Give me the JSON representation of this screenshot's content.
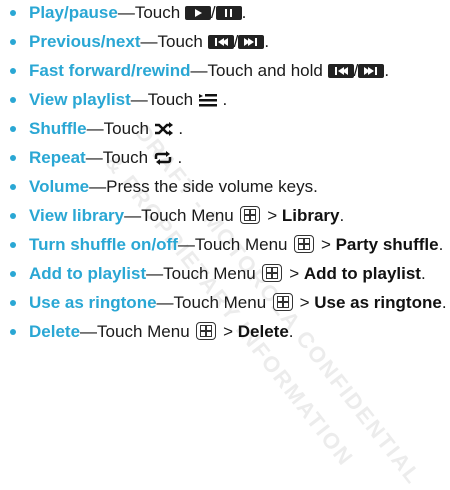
{
  "items": [
    {
      "title": "Play/pause",
      "pre": "—Touch ",
      "post": "."
    },
    {
      "title": "Previous/next",
      "pre": "—Touch ",
      "post": "."
    },
    {
      "title": "Fast forward/rewind",
      "pre": "—Touch and hold ",
      "post": "."
    },
    {
      "title": "View playlist",
      "pre": "—Touch ",
      "post": " ."
    },
    {
      "title": "Shuffle",
      "pre": "—Touch ",
      "post": " ."
    },
    {
      "title": "Repeat",
      "pre": "—Touch ",
      "post": " ."
    },
    {
      "title": "Volume",
      "pre": "—Press the side volume keys."
    },
    {
      "title": "View library",
      "pre": "—Touch Menu ",
      "gt": " > ",
      "bold": "Library",
      "post": "."
    },
    {
      "title": "Turn shuffle on/off",
      "pre": "—Touch Menu ",
      "gt": " > ",
      "bold": "Party shuffle",
      "post": "."
    },
    {
      "title": "Add to playlist",
      "pre": "—Touch Menu ",
      "gt": " > ",
      "bold": "Add to playlist",
      "post": "."
    },
    {
      "title": "Use as ringtone",
      "pre": "—Touch Menu ",
      "gt": " > ",
      "bold": "Use as ringtone",
      "post": "."
    },
    {
      "title": "Delete",
      "pre": "—Touch Menu ",
      "gt": " > ",
      "bold": "Delete",
      "post": "."
    }
  ],
  "slash": "/",
  "watermark": {
    "line1": "DRAFT - MOTOROLA CONFIDENTIAL",
    "line2": "& PROPRIETARY INFORMATION"
  },
  "colors": {
    "accent": "#2aa7d4",
    "text": "#1a1a1a",
    "button": "#222222"
  },
  "icons": [
    "play-icon",
    "pause-icon",
    "previous-icon",
    "next-icon",
    "playlist-icon",
    "shuffle-icon",
    "repeat-icon",
    "menu-key-icon"
  ]
}
